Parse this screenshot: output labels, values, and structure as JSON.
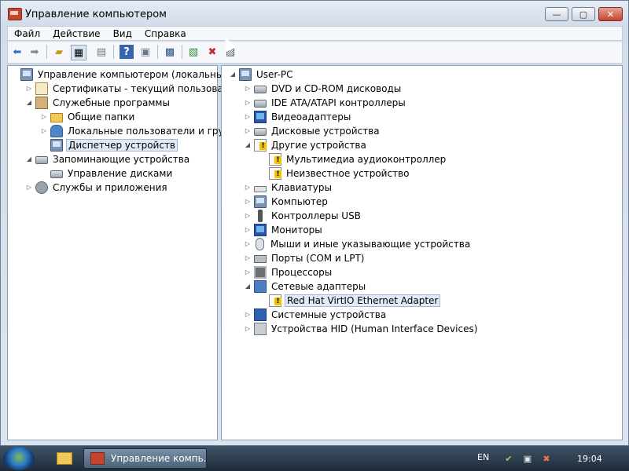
{
  "window": {
    "title": "Управление компьютером",
    "controls": {
      "minimize": "—",
      "maximize": "▢",
      "close": "✕"
    }
  },
  "menu": {
    "items": [
      "Файл",
      "Действие",
      "Вид",
      "Справка"
    ]
  },
  "toolbar": {
    "icons": [
      "back-arrow-icon",
      "forward-arrow-icon",
      "up-folder-icon",
      "show-hide-tree-icon",
      "export-list-icon",
      "help-icon",
      "properties-icon",
      "scan-hardware-icon",
      "update-driver-icon",
      "uninstall-icon",
      "disable-device-icon"
    ]
  },
  "left_tree": [
    {
      "label": "Управление компьютером (локальным)",
      "icon": "computer-management-icon",
      "level": 0,
      "expander": "",
      "selected": false
    },
    {
      "label": "Сертификаты - текущий пользователь",
      "icon": "certificate-icon",
      "level": 1,
      "expander": "▷",
      "selected": false
    },
    {
      "label": "Служебные программы",
      "icon": "tools-icon",
      "level": 1,
      "expander": "◢",
      "selected": false
    },
    {
      "label": "Общие папки",
      "icon": "shared-folders-icon",
      "level": 2,
      "expander": "▷",
      "selected": false
    },
    {
      "label": "Локальные пользователи и группы",
      "icon": "users-icon",
      "level": 2,
      "expander": "▷",
      "selected": false
    },
    {
      "label": "Диспетчер устройств",
      "icon": "device-manager-icon",
      "level": 2,
      "expander": "",
      "selected": true
    },
    {
      "label": "Запоминающие устройства",
      "icon": "storage-icon",
      "level": 1,
      "expander": "◢",
      "selected": false
    },
    {
      "label": "Управление дисками",
      "icon": "disk-management-icon",
      "level": 2,
      "expander": "",
      "selected": false
    },
    {
      "label": "Службы и приложения",
      "icon": "services-icon",
      "level": 1,
      "expander": "▷",
      "selected": false
    }
  ],
  "right_tree": [
    {
      "label": "User-PC",
      "icon": "computer-icon",
      "level": 0,
      "expander": "◢",
      "selected": false
    },
    {
      "label": "DVD и CD-ROM дисководы",
      "icon": "dvd-drive-icon",
      "level": 1,
      "expander": "▷",
      "selected": false
    },
    {
      "label": "IDE ATA/ATAPI контроллеры",
      "icon": "ide-controller-icon",
      "level": 1,
      "expander": "▷",
      "selected": false
    },
    {
      "label": "Видеоадаптеры",
      "icon": "display-adapter-icon",
      "level": 1,
      "expander": "▷",
      "selected": false
    },
    {
      "label": "Дисковые устройства",
      "icon": "disk-drive-icon",
      "level": 1,
      "expander": "▷",
      "selected": false
    },
    {
      "label": "Другие устройства",
      "icon": "other-devices-icon",
      "level": 1,
      "expander": "◢",
      "selected": false
    },
    {
      "label": "Мультимедиа аудиоконтроллер",
      "icon": "warning-device-icon",
      "level": 2,
      "expander": "",
      "selected": false
    },
    {
      "label": "Неизвестное устройство",
      "icon": "warning-device-icon",
      "level": 2,
      "expander": "",
      "selected": false
    },
    {
      "label": "Клавиатуры",
      "icon": "keyboard-icon",
      "level": 1,
      "expander": "▷",
      "selected": false
    },
    {
      "label": "Компьютер",
      "icon": "computer-icon",
      "level": 1,
      "expander": "▷",
      "selected": false
    },
    {
      "label": "Контроллеры USB",
      "icon": "usb-icon",
      "level": 1,
      "expander": "▷",
      "selected": false
    },
    {
      "label": "Мониторы",
      "icon": "monitor-icon",
      "level": 1,
      "expander": "▷",
      "selected": false
    },
    {
      "label": "Мыши и иные указывающие устройства",
      "icon": "mouse-icon",
      "level": 1,
      "expander": "▷",
      "selected": false
    },
    {
      "label": "Порты (COM и LPT)",
      "icon": "port-icon",
      "level": 1,
      "expander": "▷",
      "selected": false
    },
    {
      "label": "Процессоры",
      "icon": "processor-icon",
      "level": 1,
      "expander": "▷",
      "selected": false
    },
    {
      "label": "Сетевые адаптеры",
      "icon": "network-adapter-icon",
      "level": 1,
      "expander": "◢",
      "selected": false
    },
    {
      "label": "Red Hat VirtIO Ethernet Adapter",
      "icon": "warning-device-icon",
      "level": 2,
      "expander": "",
      "selected": true
    },
    {
      "label": "Системные устройства",
      "icon": "system-devices-icon",
      "level": 1,
      "expander": "▷",
      "selected": false
    },
    {
      "label": "Устройства HID (Human Interface Devices)",
      "icon": "hid-icon",
      "level": 1,
      "expander": "▷",
      "selected": false
    }
  ],
  "taskbar": {
    "task_label": "Управление компь...",
    "language": "EN",
    "clock": "19:04",
    "tray_icons": [
      "action-center-icon",
      "network-disconnected-icon",
      "volume-muted-icon"
    ]
  }
}
